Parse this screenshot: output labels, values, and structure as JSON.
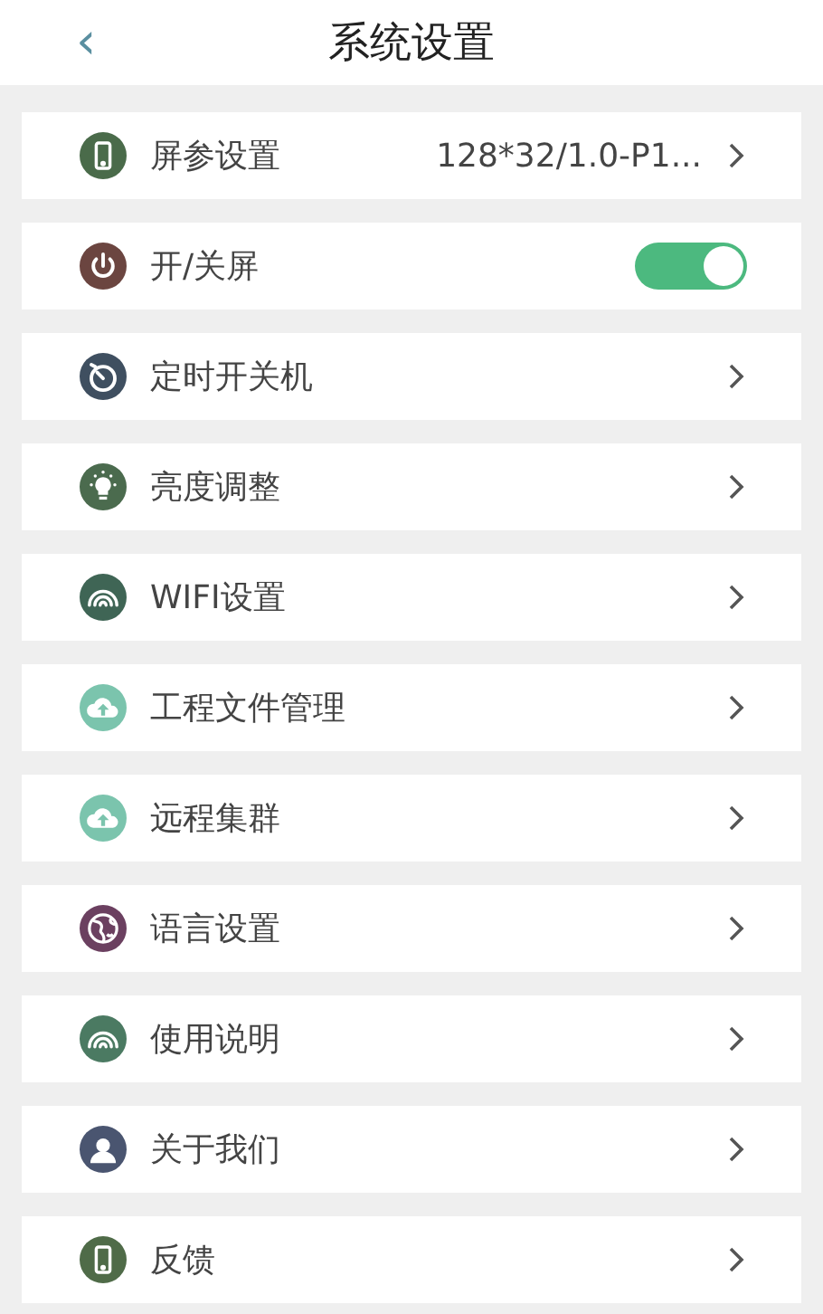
{
  "header": {
    "back": "‹",
    "title": "系统设置"
  },
  "items": [
    {
      "kind": "link",
      "label": "屏参设置",
      "value": "128*32/1.0-P1...",
      "color": "#4a6b4a"
    },
    {
      "kind": "toggle",
      "label": "开/关屏",
      "on": true,
      "color": "#6b4540"
    },
    {
      "kind": "link",
      "label": "定时开关机",
      "color": "#3f4f60"
    },
    {
      "kind": "link",
      "label": "亮度调整",
      "color": "#4b6b4e"
    },
    {
      "kind": "link",
      "label": "WIFI设置",
      "color": "#3f6555"
    },
    {
      "kind": "link",
      "label": "工程文件管理",
      "color": "#7bc4ad"
    },
    {
      "kind": "link",
      "label": "远程集群",
      "color": "#7bc4ad"
    },
    {
      "kind": "link",
      "label": "语言设置",
      "color": "#6b4060"
    },
    {
      "kind": "link",
      "label": "使用说明",
      "color": "#4b7a62"
    },
    {
      "kind": "link",
      "label": "关于我们",
      "color": "#4a5570"
    },
    {
      "kind": "link",
      "label": "反馈",
      "color": "#4f6b48"
    }
  ]
}
